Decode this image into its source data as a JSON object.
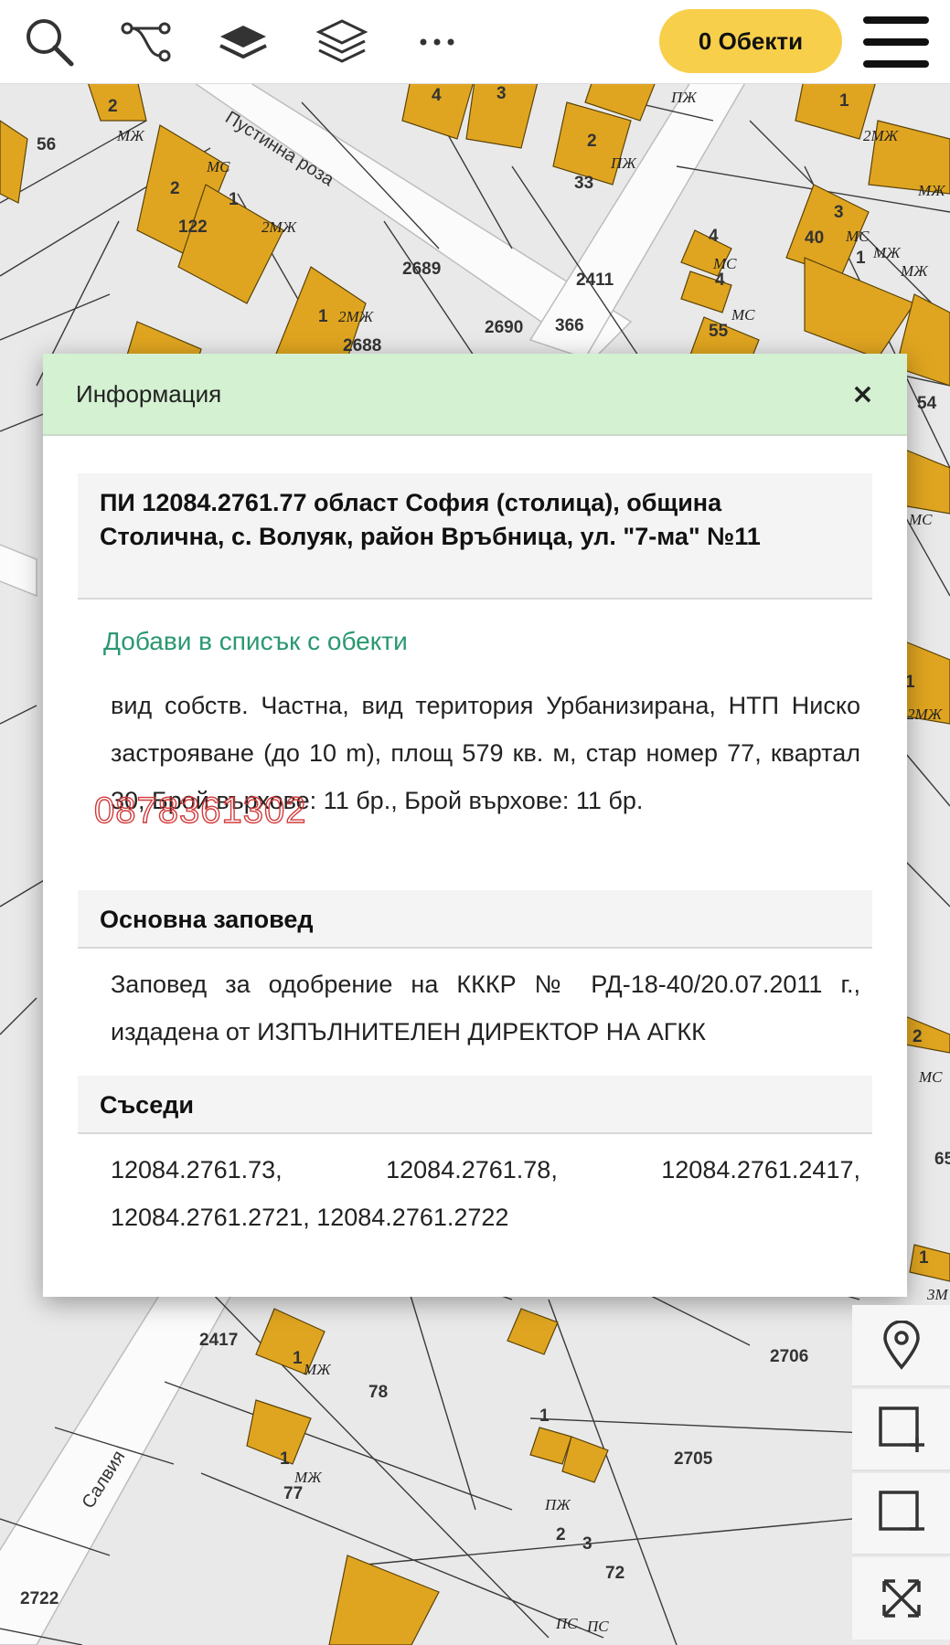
{
  "toolbar": {
    "icons": [
      "search-icon",
      "route-icon",
      "layer-filled-icon",
      "layers-icon",
      "more-icon",
      "menu-icon"
    ],
    "objects_label": "0 Обекти"
  },
  "map": {
    "streets": [
      "Пустинна роза",
      "Салвия"
    ],
    "lot_numbers": [
      "56",
      "122",
      "2689",
      "2688",
      "2690",
      "366",
      "33",
      "2411",
      "40",
      "55",
      "54",
      "2417",
      "78",
      "77",
      "2706",
      "2705",
      "72",
      "2722",
      "65"
    ],
    "building_numbers": [
      "2",
      "1",
      "2",
      "4",
      "3",
      "2",
      "1",
      "3",
      "1",
      "4",
      "4",
      "1",
      "1",
      "1",
      "1",
      "1",
      "2",
      "3",
      "2",
      "1"
    ],
    "building_codes": [
      "МС",
      "МЖ",
      "МС",
      "2МЖ",
      "2МЖ",
      "ПЖ",
      "ПЖ",
      "МС",
      "МС",
      "МЖ",
      "МЖ",
      "МЖ",
      "2МЖ",
      "МС",
      "МЖ",
      "МЖ",
      "ПЖ",
      "ПС",
      "ПС",
      "МС",
      "МС",
      "2МЖ",
      "3М"
    ],
    "colors": {
      "building": "#e0a520",
      "building_stroke": "#5a4308",
      "street": "#fbfbfb",
      "background": "#e9e9e9",
      "parcel_line": "#3a3a3a"
    }
  },
  "panel": {
    "title": "Информация",
    "close_label": "×",
    "heading": "ПИ 12084.2761.77 област София (столица), община Столична, с. Волуяк, район Връбница, ул. \"7-ма\" №11",
    "add_link": "Добави в списък с обекти",
    "details": "вид собств. Частна, вид територия Урбанизирана, НТП Ниско застрояване (до 10 m), площ 579 кв. м, стар номер 77, квартал 30, Брой върхове: 11 бр., Брой върхове: 11 бр.",
    "order_header": "Основна заповед",
    "order_text": "Заповед за одобрение на КККР № РД-18-40/20.07.2011 г., издадена от ИЗПЪЛНИТЕЛЕН ДИРЕКТОР НА АГКК",
    "neighbors_header": "Съседи",
    "neighbors_text": "12084.2761.73, 12084.2761.78, 12084.2761.2417, 12084.2761.2721, 12084.2761.2722",
    "watermark": "0878361302"
  },
  "side_controls": [
    "location-pin-icon",
    "select-add-icon",
    "select-remove-icon",
    "fullscreen-icon"
  ]
}
